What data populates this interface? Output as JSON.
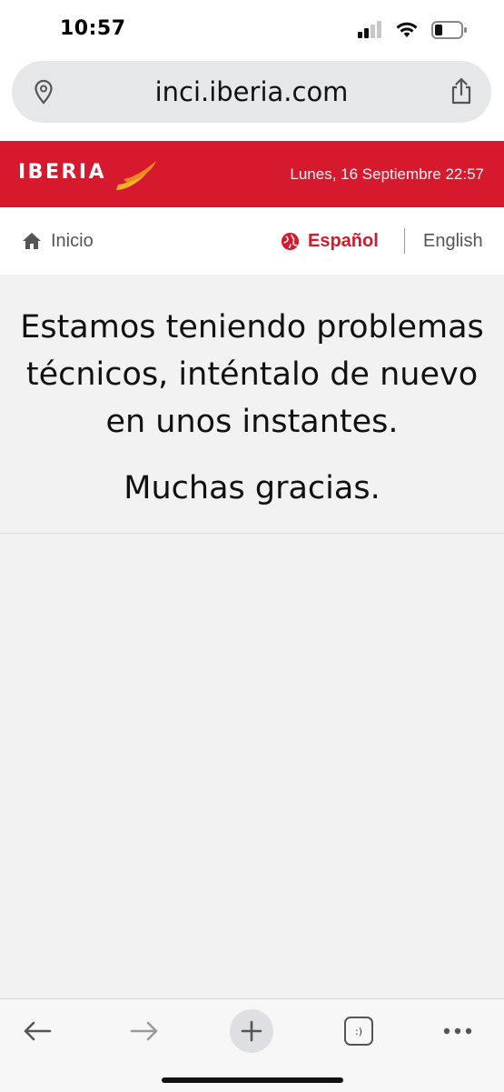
{
  "status_bar": {
    "time": "10:57"
  },
  "browser": {
    "url": "inci.iberia.com",
    "icons": {
      "location": "location-pin-icon",
      "share": "share-icon"
    }
  },
  "header": {
    "logo_text": "IBERIA",
    "date": "Lunes, 16 Septiembre 22:57",
    "brand_color": "#d7192d"
  },
  "nav": {
    "home_label": "Inicio",
    "language_selected": "Español",
    "language_other": "English"
  },
  "main": {
    "message": "Estamos teniendo problemas técnicos, inténtalo de nuevo en unos instantes.",
    "thanks": "Muchas gracias."
  },
  "toolbar": {
    "tabs_label": ":)",
    "icons": [
      "back-icon",
      "forward-icon",
      "new-tab-icon",
      "tabs-icon",
      "more-icon"
    ]
  }
}
